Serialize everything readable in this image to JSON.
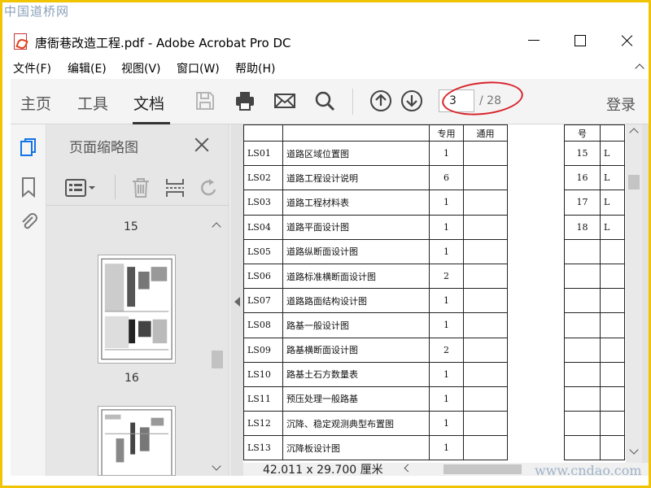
{
  "watermark_top": "中国道桥网",
  "watermark_bottom": "www.cndao.com",
  "window": {
    "title": "唐衙巷改造工程.pdf - Adobe Acrobat Pro DC"
  },
  "menu": [
    "文件(F)",
    "编辑(E)",
    "视图(V)",
    "窗口(W)",
    "帮助(H)"
  ],
  "toolbar": {
    "tabs": [
      "主页",
      "工具",
      "文档"
    ],
    "active_tab": "文档",
    "icons": [
      "save-icon",
      "print-icon",
      "email-icon",
      "search-icon",
      "page-up-icon",
      "page-down-icon"
    ],
    "page_current": "3",
    "page_total": "/ 28",
    "signin": "登录"
  },
  "left_rail": {
    "icons": [
      "page-thumbnails-icon",
      "bookmark-icon",
      "attachment-icon"
    ]
  },
  "thumbnail_panel": {
    "title": "页面缩略图",
    "tools": [
      "page-options-icon",
      "delete-icon",
      "insert-page-icon",
      "rotate-icon"
    ],
    "page_labels": [
      "15",
      "16"
    ]
  },
  "document": {
    "header": {
      "used": "专用",
      "general": "通用",
      "no": "号"
    },
    "rows": [
      {
        "code": "LS01",
        "name": "道路区域位置图",
        "count": "1"
      },
      {
        "code": "LS02",
        "name": "道路工程设计说明",
        "count": "6"
      },
      {
        "code": "LS03",
        "name": "道路工程材料表",
        "count": "1"
      },
      {
        "code": "LS04",
        "name": "道路平面设计图",
        "count": "1"
      },
      {
        "code": "LS05",
        "name": "道路纵断面设计图",
        "count": "1"
      },
      {
        "code": "LS06",
        "name": "道路标准横断面设计图",
        "count": "2"
      },
      {
        "code": "LS07",
        "name": "道路路面结构设计图",
        "count": "1"
      },
      {
        "code": "LS08",
        "name": "路基一般设计图",
        "count": "1"
      },
      {
        "code": "LS09",
        "name": "路基横断面设计图",
        "count": "2"
      },
      {
        "code": "LS10",
        "name": "路基土石方数量表",
        "count": "1"
      },
      {
        "code": "LS11",
        "name": "预压处理一般路基",
        "count": "1"
      },
      {
        "code": "LS12",
        "name": "沉降、稳定观测典型布置图",
        "count": "1"
      },
      {
        "code": "LS13",
        "name": "沉降板设计图",
        "count": "1"
      }
    ],
    "right_rows": [
      {
        "idx": "15",
        "cut": "L"
      },
      {
        "idx": "16",
        "cut": "L"
      },
      {
        "idx": "17",
        "cut": "L"
      },
      {
        "idx": "18",
        "cut": "L"
      }
    ]
  },
  "status": {
    "doc_size": "42.011 x 29.700 厘米"
  },
  "colors": {
    "accent_red": "#d8232a",
    "frame_yellow": "#f0c400"
  }
}
